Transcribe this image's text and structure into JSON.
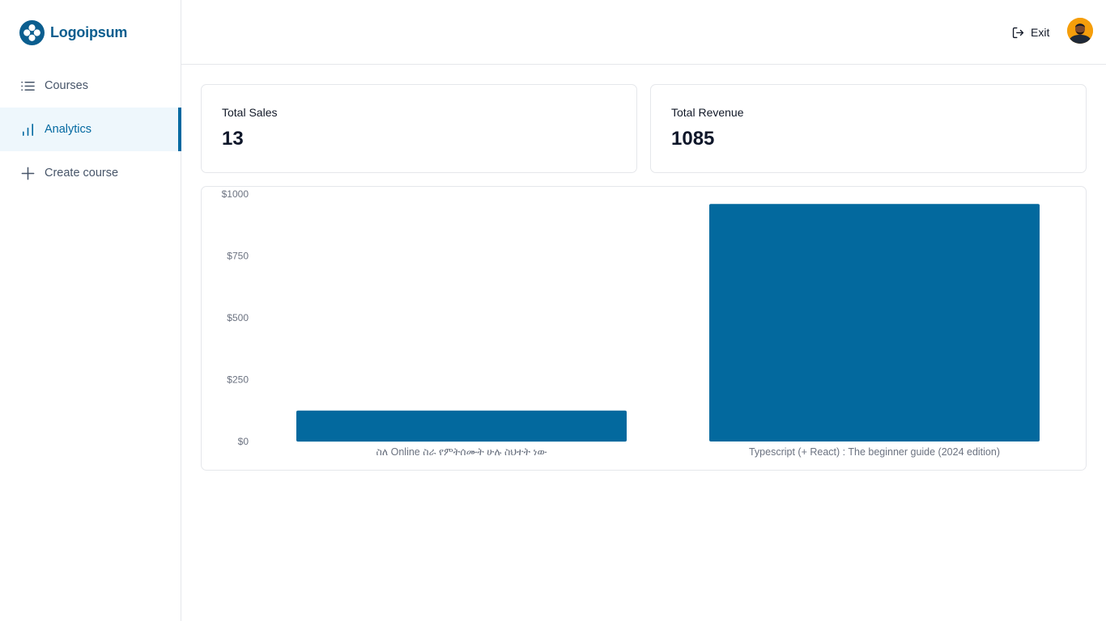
{
  "brand": {
    "name": "Logoipsum",
    "color": "#0b5e8f"
  },
  "sidebar": {
    "items": [
      {
        "label": "Courses",
        "icon": "list-icon",
        "active": false
      },
      {
        "label": "Analytics",
        "icon": "bar-chart-icon",
        "active": true
      },
      {
        "label": "Create course",
        "icon": "plus-icon",
        "active": false
      }
    ]
  },
  "header": {
    "exit_label": "Exit",
    "exit_icon": "logout-icon",
    "avatar_icon": "user-avatar"
  },
  "stats": {
    "total_sales": {
      "label": "Total Sales",
      "value": "13"
    },
    "total_revenue": {
      "label": "Total Revenue",
      "value": "1085"
    }
  },
  "colors": {
    "accent": "#0369a1",
    "bar": "#03699e"
  },
  "chart_data": {
    "type": "bar",
    "categories": [
      "ስለ Online ስራ የምትሰሙት ሁሉ ስህተት ነው",
      "Typescript (+ React) : The beginner guide (2024 edition)"
    ],
    "values": [
      125,
      960
    ],
    "ylim": [
      0,
      1000
    ],
    "yticks": [
      0,
      250,
      500,
      750,
      1000
    ],
    "ytick_labels": [
      "$0",
      "$250",
      "$500",
      "$750",
      "$1000"
    ],
    "grid": false,
    "legend": "none"
  }
}
